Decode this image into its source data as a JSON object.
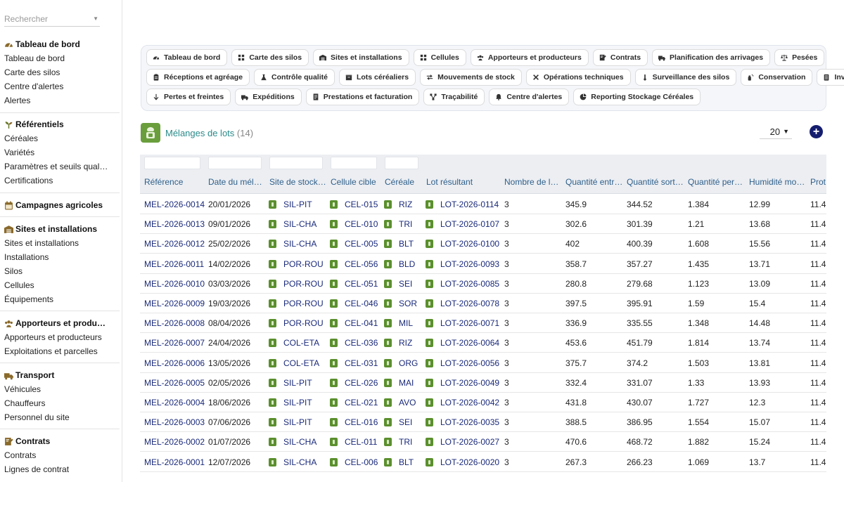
{
  "sidebar": {
    "search_placeholder": "Rechercher",
    "sections": [
      {
        "title": "Tableau de bord",
        "icon": "gauge-icon",
        "items": [
          "Tableau de bord",
          "Carte des silos",
          "Centre d'alertes",
          "Alertes"
        ]
      },
      {
        "title": "Référentiels",
        "icon": "sprout-icon",
        "items": [
          "Céréales",
          "Variétés",
          "Paramètres et seuils qual…",
          "Certifications"
        ]
      },
      {
        "title": "Campagnes agricoles",
        "icon": "calendar-icon",
        "items": []
      },
      {
        "title": "Sites et installations",
        "icon": "warehouse-icon",
        "items": [
          "Sites et installations",
          "Installations",
          "Silos",
          "Cellules",
          "Équipements"
        ]
      },
      {
        "title": "Apporteurs et produ…",
        "icon": "users-icon",
        "items": [
          "Apporteurs et producteurs",
          "Exploitations et parcelles"
        ]
      },
      {
        "title": "Transport",
        "icon": "truck-icon",
        "items": [
          "Véhicules",
          "Chauffeurs",
          "Personnel du site"
        ]
      },
      {
        "title": "Contrats",
        "icon": "contract-icon",
        "items": [
          "Contrats",
          "Lignes de contrat"
        ]
      }
    ]
  },
  "nav": {
    "rows": [
      [
        {
          "label": "Tableau de bord",
          "icon": "gauge-icon"
        },
        {
          "label": "Carte des silos",
          "icon": "grid-icon"
        },
        {
          "label": "Sites et installations",
          "icon": "warehouse-icon"
        },
        {
          "label": "Cellules",
          "icon": "grid-icon"
        },
        {
          "label": "Apporteurs et producteurs",
          "icon": "users-icon"
        },
        {
          "label": "Contrats",
          "icon": "contract-icon"
        },
        {
          "label": "Planification des arrivages",
          "icon": "truck-icon"
        },
        {
          "label": "Pesées",
          "icon": "scale-icon"
        }
      ],
      [
        {
          "label": "Réceptions et agréage",
          "icon": "clipboard-icon"
        },
        {
          "label": "Contrôle qualité",
          "icon": "flask-icon"
        },
        {
          "label": "Lots céréaliers",
          "icon": "box-icon"
        },
        {
          "label": "Mouvements de stock",
          "icon": "arrows-icon"
        },
        {
          "label": "Opérations techniques",
          "icon": "tools-icon"
        },
        {
          "label": "Surveillance des silos",
          "icon": "thermometer-icon"
        },
        {
          "label": "Conservation",
          "icon": "spray-icon"
        },
        {
          "label": "Inventaires",
          "icon": "list-icon"
        }
      ],
      [
        {
          "label": "Pertes et freintes",
          "icon": "arrow-down-icon"
        },
        {
          "label": "Expéditions",
          "icon": "truck-icon"
        },
        {
          "label": "Prestations et facturation",
          "icon": "invoice-icon"
        },
        {
          "label": "Traçabilité",
          "icon": "network-icon"
        },
        {
          "label": "Centre d'alertes",
          "icon": "bell-icon"
        },
        {
          "label": "Reporting Stockage Céréales",
          "icon": "pie-icon"
        }
      ]
    ]
  },
  "main": {
    "title": "Mélanges de lots",
    "count": "(14)",
    "page_size": "20",
    "add_label": "+"
  },
  "table": {
    "columns": [
      "Référence",
      "Date du mél…",
      "Site de stock…",
      "Cellule cible",
      "Céréale",
      "Lot résultant",
      "Nombre de l…",
      "Quantité entr…",
      "Quantité sort…",
      "Quantité per…",
      "Humidité mo…",
      "Prot"
    ],
    "rows": [
      [
        "MEL-2026-0014",
        "20/01/2026",
        "SIL-PIT",
        "CEL-015",
        "RIZ",
        "LOT-2026-0114",
        "3",
        "345.9",
        "344.52",
        "1.384",
        "12.99",
        "11.4"
      ],
      [
        "MEL-2026-0013",
        "09/01/2026",
        "SIL-CHA",
        "CEL-010",
        "TRI",
        "LOT-2026-0107",
        "3",
        "302.6",
        "301.39",
        "1.21",
        "13.68",
        "11.4"
      ],
      [
        "MEL-2026-0012",
        "25/02/2026",
        "SIL-CHA",
        "CEL-005",
        "BLT",
        "LOT-2026-0100",
        "3",
        "402",
        "400.39",
        "1.608",
        "15.56",
        "11.4"
      ],
      [
        "MEL-2026-0011",
        "14/02/2026",
        "POR-ROU",
        "CEL-056",
        "BLD",
        "LOT-2026-0093",
        "3",
        "358.7",
        "357.27",
        "1.435",
        "13.71",
        "11.4"
      ],
      [
        "MEL-2026-0010",
        "03/03/2026",
        "POR-ROU",
        "CEL-051",
        "SEI",
        "LOT-2026-0085",
        "3",
        "280.8",
        "279.68",
        "1.123",
        "13.09",
        "11.4"
      ],
      [
        "MEL-2026-0009",
        "19/03/2026",
        "POR-ROU",
        "CEL-046",
        "SOR",
        "LOT-2026-0078",
        "3",
        "397.5",
        "395.91",
        "1.59",
        "15.4",
        "11.4"
      ],
      [
        "MEL-2026-0008",
        "08/04/2026",
        "POR-ROU",
        "CEL-041",
        "MIL",
        "LOT-2026-0071",
        "3",
        "336.9",
        "335.55",
        "1.348",
        "14.48",
        "11.4"
      ],
      [
        "MEL-2026-0007",
        "24/04/2026",
        "COL-ETA",
        "CEL-036",
        "RIZ",
        "LOT-2026-0064",
        "3",
        "453.6",
        "451.79",
        "1.814",
        "13.74",
        "11.4"
      ],
      [
        "MEL-2026-0006",
        "13/05/2026",
        "COL-ETA",
        "CEL-031",
        "ORG",
        "LOT-2026-0056",
        "3",
        "375.7",
        "374.2",
        "1.503",
        "13.81",
        "11.4"
      ],
      [
        "MEL-2026-0005",
        "02/05/2026",
        "SIL-PIT",
        "CEL-026",
        "MAI",
        "LOT-2026-0049",
        "3",
        "332.4",
        "331.07",
        "1.33",
        "13.93",
        "11.4"
      ],
      [
        "MEL-2026-0004",
        "18/06/2026",
        "SIL-PIT",
        "CEL-021",
        "AVO",
        "LOT-2026-0042",
        "3",
        "431.8",
        "430.07",
        "1.727",
        "12.3",
        "11.4"
      ],
      [
        "MEL-2026-0003",
        "07/06/2026",
        "SIL-PIT",
        "CEL-016",
        "SEI",
        "LOT-2026-0035",
        "3",
        "388.5",
        "386.95",
        "1.554",
        "15.07",
        "11.4"
      ],
      [
        "MEL-2026-0002",
        "01/07/2026",
        "SIL-CHA",
        "CEL-011",
        "TRI",
        "LOT-2026-0027",
        "3",
        "470.6",
        "468.72",
        "1.882",
        "15.24",
        "11.4"
      ],
      [
        "MEL-2026-0001",
        "12/07/2026",
        "SIL-CHA",
        "CEL-006",
        "BLT",
        "LOT-2026-0020",
        "3",
        "267.3",
        "266.23",
        "1.069",
        "13.7",
        "11.4"
      ]
    ]
  },
  "colors": {
    "accent_green": "#6a9e3c",
    "title_teal": "#2a8a8a",
    "link_navy": "#1a2a7a",
    "add_button": "#151d6e"
  }
}
